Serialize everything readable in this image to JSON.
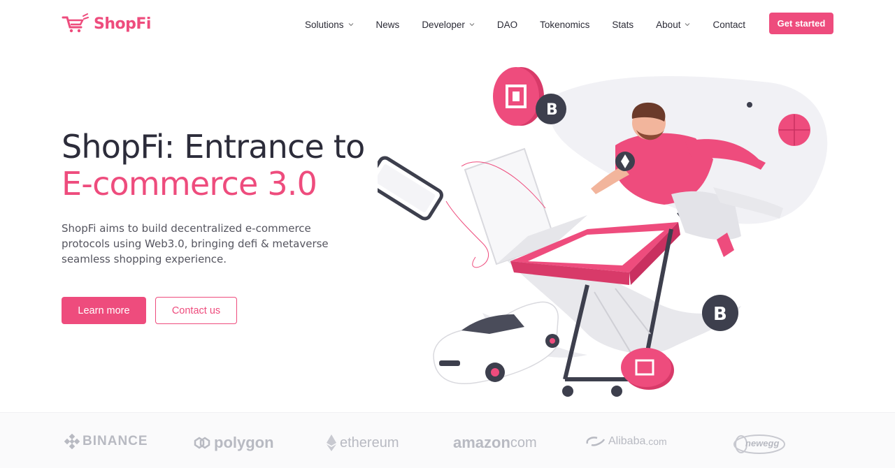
{
  "brand": {
    "name": "ShopFi",
    "accent": "#ee4c7d"
  },
  "nav": {
    "items": [
      {
        "label": "Solutions",
        "has_dropdown": true
      },
      {
        "label": "News",
        "has_dropdown": false
      },
      {
        "label": "Developer",
        "has_dropdown": true
      },
      {
        "label": "DAO",
        "has_dropdown": false
      },
      {
        "label": "Tokenomics",
        "has_dropdown": false
      },
      {
        "label": "Stats",
        "has_dropdown": false
      },
      {
        "label": "About",
        "has_dropdown": true
      },
      {
        "label": "Contact",
        "has_dropdown": false
      }
    ],
    "cta_label": "Get started"
  },
  "hero": {
    "title_line1": "ShopFi: Entrance to",
    "title_line2": "E-commerce 3.0",
    "description": "ShopFi aims to build decentralized e-commerce protocols using Web3.0, bringing defi & metaverse seamless shopping experience.",
    "primary_button": "Learn more",
    "secondary_button": "Contact us"
  },
  "partners": [
    {
      "name": "BINANCE",
      "icon": "binance-icon"
    },
    {
      "name": "polygon",
      "icon": "polygon-icon"
    },
    {
      "name": "ethereum",
      "icon": "ethereum-icon"
    },
    {
      "name": "amazon",
      "suffix": "com",
      "icon": "amazon-logo"
    },
    {
      "name": "Alibaba",
      "suffix": ".com",
      "icon": "alibaba-icon"
    },
    {
      "name": "newegg",
      "icon": "newegg-logo"
    }
  ],
  "colors": {
    "accent": "#ee4c7d",
    "text_dark": "#2c2c3a",
    "muted": "#b8bac2"
  }
}
